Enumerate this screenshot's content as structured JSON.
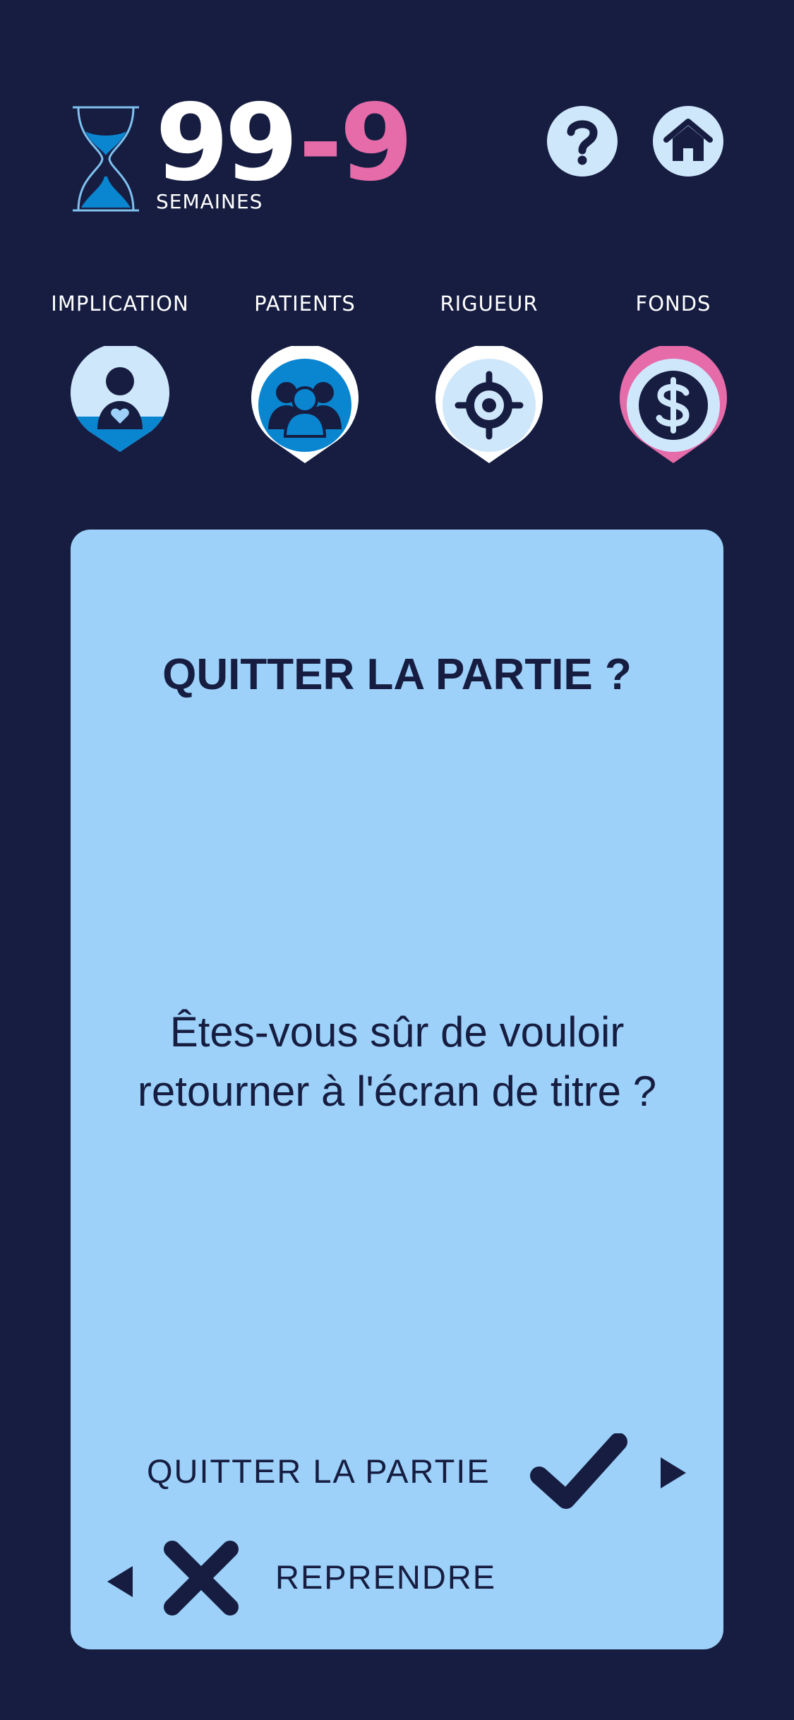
{
  "hud": {
    "weeks_value": "99",
    "weeks_delta": "-9",
    "weeks_label": "SEMAINES",
    "help_icon": "question-icon",
    "home_icon": "home-icon"
  },
  "stats": [
    {
      "label": "IMPLICATION",
      "icon": "person-heart-icon",
      "fill_level": 0.35
    },
    {
      "label": "PATIENTS",
      "icon": "group-icon",
      "fill_level": 1.0
    },
    {
      "label": "RIGUEUR",
      "icon": "target-icon",
      "fill_level": 0.0
    },
    {
      "label": "FONDS",
      "icon": "dollar-icon",
      "fill_level": 0.0
    }
  ],
  "dialog": {
    "title": "QUITTER LA PARTIE ?",
    "message": "Êtes-vous sûr de vouloir retourner à l'écran de titre ?",
    "confirm_label": "QUITTER LA PARTIE",
    "cancel_label": "REPRENDRE"
  },
  "colors": {
    "background": "#161d41",
    "card": "#9dd1f9",
    "accent_pink": "#e56ba9",
    "accent_blue": "#0a86d1",
    "light_blue": "#cfe7fb"
  }
}
